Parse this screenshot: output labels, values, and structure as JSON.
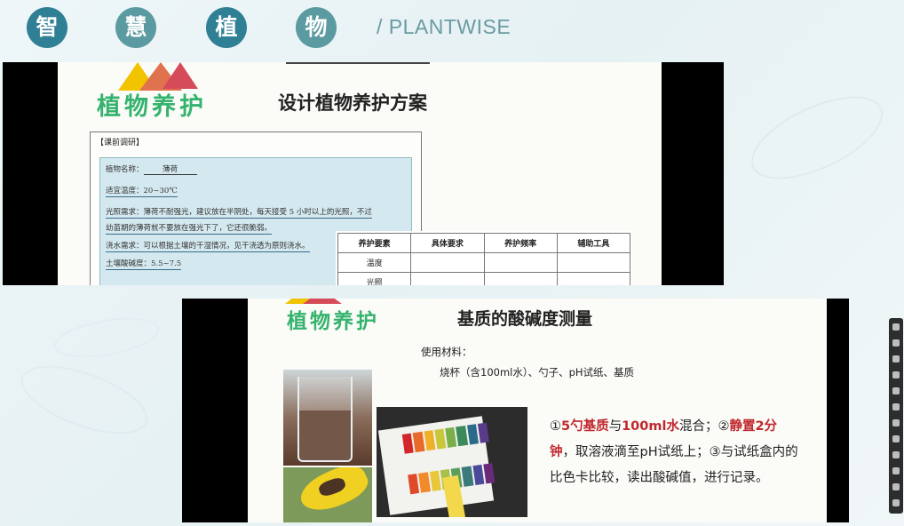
{
  "header": {
    "badges": [
      "智",
      "慧",
      "植",
      "物"
    ],
    "brand": "/ PLANTWISE"
  },
  "slide_top": {
    "logo_text": "植物养护",
    "title": "设计植物养护方案",
    "research_title": "【课前调研】",
    "plant_name_label": "植物名称：",
    "plant_name_value": "薄荷",
    "temp": "适宜温度：20~30℃",
    "light_1": "光照需求：薄荷不耐强光，建议放在半阴处，每天接受 5 小时以上的光照，不过",
    "light_2": "幼苗期的薄荷就不要放在强光下了，它还很脆弱。",
    "water": "浇水需求：可以根据土壤的干湿情况，见干浇透为原则浇水。",
    "ph": "土壤酸碱度：5.5~7.5",
    "table": {
      "headers": [
        "养护要素",
        "具体要求",
        "养护频率",
        "辅助工具"
      ],
      "rows": [
        [
          "温度",
          "",
          "",
          ""
        ],
        [
          "光照",
          "",
          "",
          ""
        ]
      ]
    }
  },
  "slide_bottom": {
    "logo_text": "植物养护",
    "title": "基质的酸碱度测量",
    "materials_label": "使用材料：",
    "materials_list": "烧杯（含100ml水）、勺子、pH试纸、基质",
    "step1_num": "①",
    "step1_a": "5勺基质",
    "step1_b": "与",
    "step1_c": "100ml水",
    "step1_d": "混合；②",
    "step2_a": "静置2分钟",
    "step2_b": "，取溶液滴至pH试纸上；③与试纸盒内的比色卡比较，读出酸碱值，进行记录。"
  },
  "colors": {
    "badge_dark": "#2f7f95",
    "badge_light": "#5a9aa0",
    "brand": "#6a9aa3",
    "logo_green": "#35b36e",
    "highlight_red": "#c0282d"
  }
}
